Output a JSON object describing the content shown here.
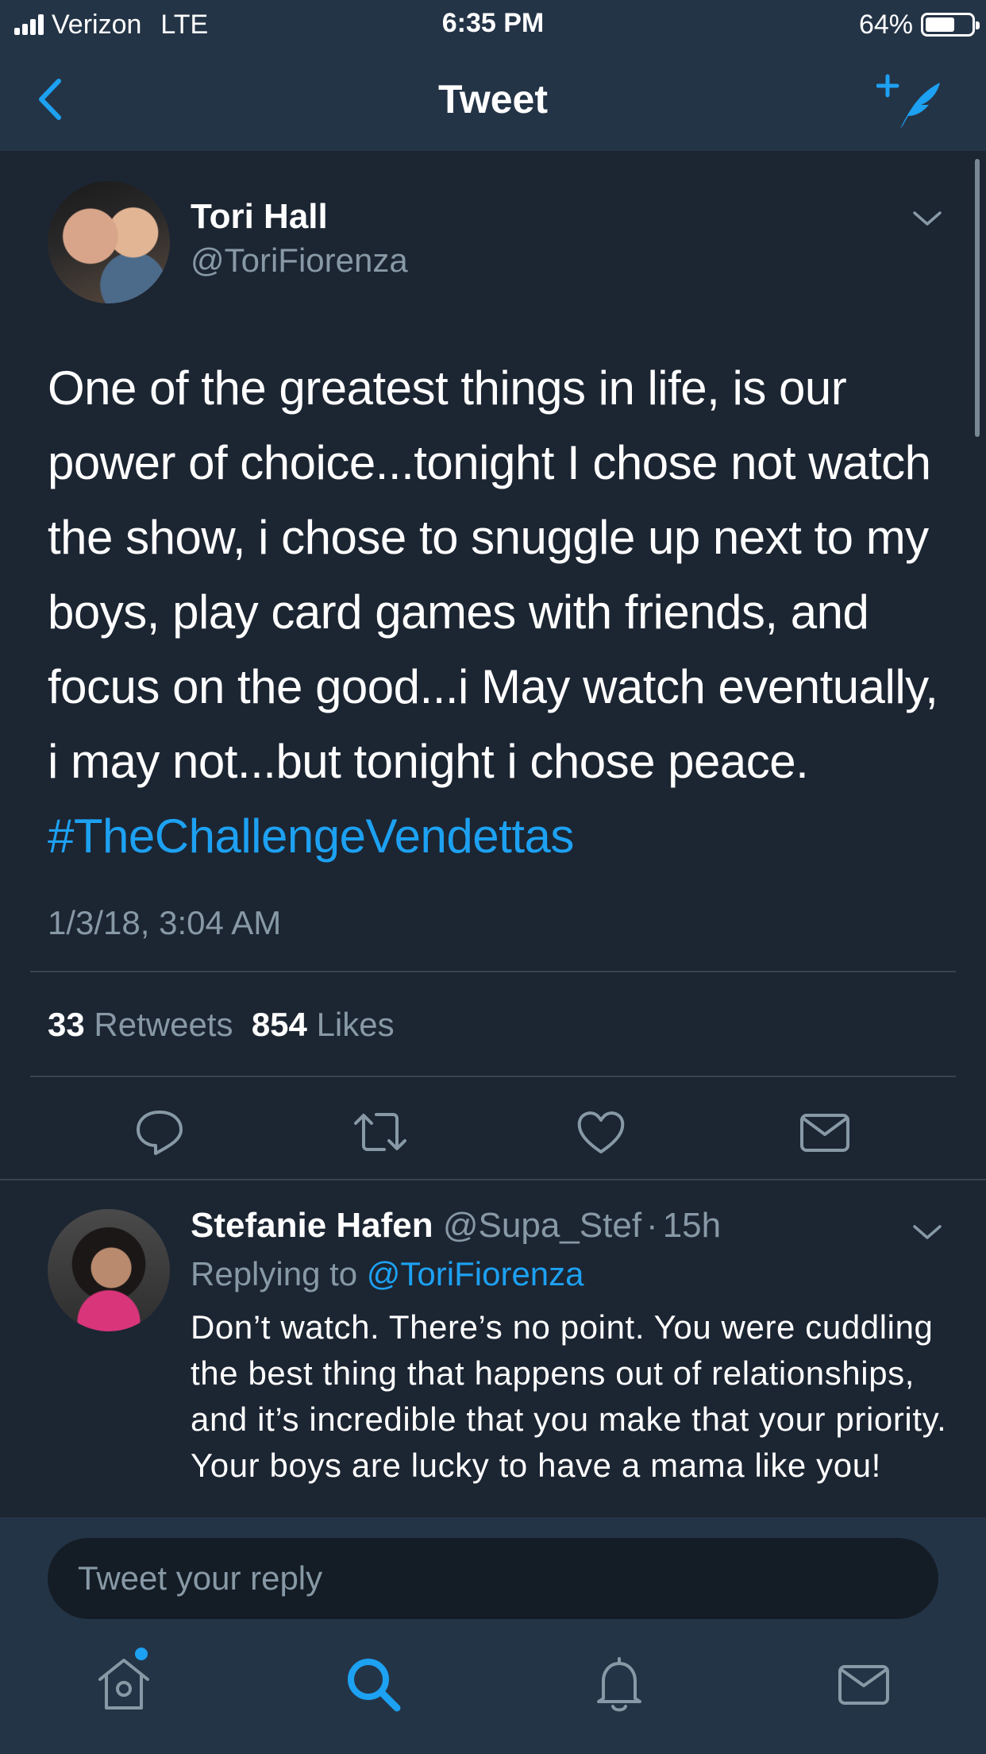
{
  "status_bar": {
    "carrier": "Verizon",
    "network": "LTE",
    "time": "6:35 PM",
    "battery_percent": "64%",
    "battery_level": 0.64
  },
  "nav": {
    "title": "Tweet",
    "back_icon": "chevron-left-icon",
    "compose_icon": "compose-feather-icon"
  },
  "tweet": {
    "author_name": "Tori Hall",
    "author_handle": "@ToriFiorenza",
    "text": "One of the greatest things in life, is our power of choice...tonight I chose not watch the show, i chose to snuggle up next to my boys, play card games with friends, and focus on the good...i May watch eventually, i may not...but tonight i chose peace.",
    "hashtag": "#TheChallengeVendettas",
    "timestamp": "1/3/18, 3:04 AM",
    "retweets_count": "33",
    "retweets_label": "Retweets",
    "likes_count": "854",
    "likes_label": "Likes"
  },
  "reply": {
    "name": "Stefanie Hafen",
    "handle": "@Supa_Stef",
    "separator": "·",
    "time": "15h",
    "replying_prefix": "Replying to",
    "replying_to": "@ToriFiorenza",
    "text": "Don’t watch. There’s no point. You were cuddling the best thing that happens out of relationships, and it’s incredible that you make that your priority. Your boys are lucky to have a mama like you!"
  },
  "reply_box": {
    "placeholder": "Tweet your reply"
  },
  "colors": {
    "background": "#1c2532",
    "bar": "#243447",
    "accent": "#1da1f2",
    "muted": "#8899a6",
    "divider": "#38444d"
  },
  "tab_bar": {
    "items": [
      "home-icon",
      "search-icon",
      "notifications-icon",
      "messages-icon"
    ],
    "active": "search-icon"
  }
}
